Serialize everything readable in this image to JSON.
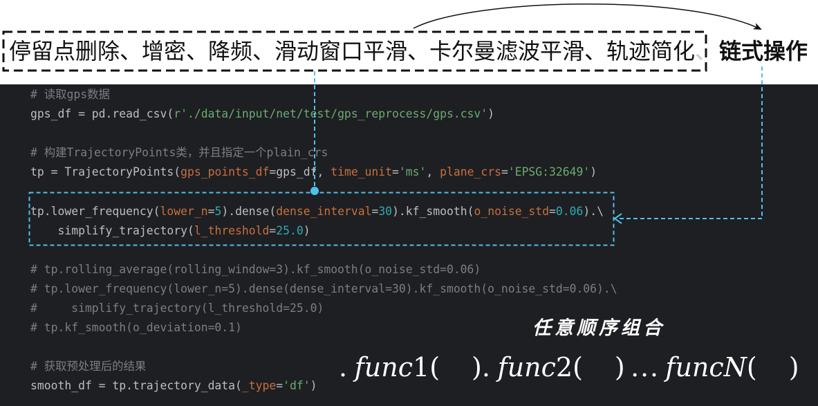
{
  "top_box": {
    "steps": "停留点删除、增密、降频、滑动窗口平滑、卡尔曼滤波平滑、轨迹简化",
    "trailing": "、"
  },
  "chain_label": "链式操作",
  "order_label": "任意顺序组合",
  "formula": {
    "parts": [
      ".",
      "func",
      "1",
      "(",
      ")",
      ".",
      "func",
      "2",
      "(",
      ")",
      "...",
      "func",
      "N",
      "(",
      ")"
    ]
  },
  "code": {
    "lines": [
      [
        {
          "cm": "# 读取gps数据"
        }
      ],
      [
        {
          "id": "gps_df = pd.read_csv("
        },
        {
          "str": "r'./data/input/net/test/gps_reprocess/gps.csv'"
        },
        {
          "id": ")"
        }
      ],
      [],
      [
        {
          "cm": "# 构建TrajectoryPoints类，并且指定一个plain_crs"
        }
      ],
      [
        {
          "id": "tp = TrajectoryPoints("
        },
        {
          "arg": "gps_points_df"
        },
        {
          "id": "=gps_df, "
        },
        {
          "arg": "time_unit"
        },
        {
          "id": "="
        },
        {
          "str": "'ms'"
        },
        {
          "id": ", "
        },
        {
          "arg": "plane_crs"
        },
        {
          "id": "="
        },
        {
          "str": "'EPSG:32649'"
        },
        {
          "id": ")"
        }
      ],
      [],
      [
        {
          "id": "tp.lower_frequency("
        },
        {
          "arg": "lower_n"
        },
        {
          "id": "="
        },
        {
          "num": "5"
        },
        {
          "id": ").dense("
        },
        {
          "arg": "dense_interval"
        },
        {
          "id": "="
        },
        {
          "num": "30"
        },
        {
          "id": ").kf_smooth("
        },
        {
          "arg": "o_noise_std"
        },
        {
          "id": "="
        },
        {
          "num": "0.06"
        },
        {
          "id": ").\\"
        }
      ],
      [
        {
          "id": "    simplify_trajectory("
        },
        {
          "arg": "l_threshold"
        },
        {
          "id": "="
        },
        {
          "num": "25.0"
        },
        {
          "id": ")"
        }
      ],
      [],
      [
        {
          "cm": "# tp.rolling_average(rolling_window=3).kf_smooth(o_noise_std=0.06)"
        }
      ],
      [
        {
          "cm": "# tp.lower_frequency(lower_n=5).dense(dense_interval=30).kf_smooth(o_noise_std=0.06).\\"
        }
      ],
      [
        {
          "cm": "#     simplify_trajectory(l_threshold=25.0)"
        }
      ],
      [
        {
          "cm": "# tp.kf_smooth(o_deviation=0.1)"
        }
      ],
      [],
      [
        {
          "cm": "# 获取预处理后的结果"
        }
      ],
      [
        {
          "id": "smooth_df = tp.trajectory_data("
        },
        {
          "arg": "_type"
        },
        {
          "id": "="
        },
        {
          "str": "'df'"
        },
        {
          "id": ")"
        }
      ]
    ]
  },
  "colors": {
    "code_bg": "#1e1f22",
    "id": "#bcbec4",
    "cm": "#7a7e85",
    "str": "#6aab73",
    "num": "#2aacb8",
    "arg": "#c8703f",
    "annotation_blue": "#4fc1ee",
    "ink": "#111111",
    "faint": "#c9c9c9",
    "white": "#ffffff"
  }
}
